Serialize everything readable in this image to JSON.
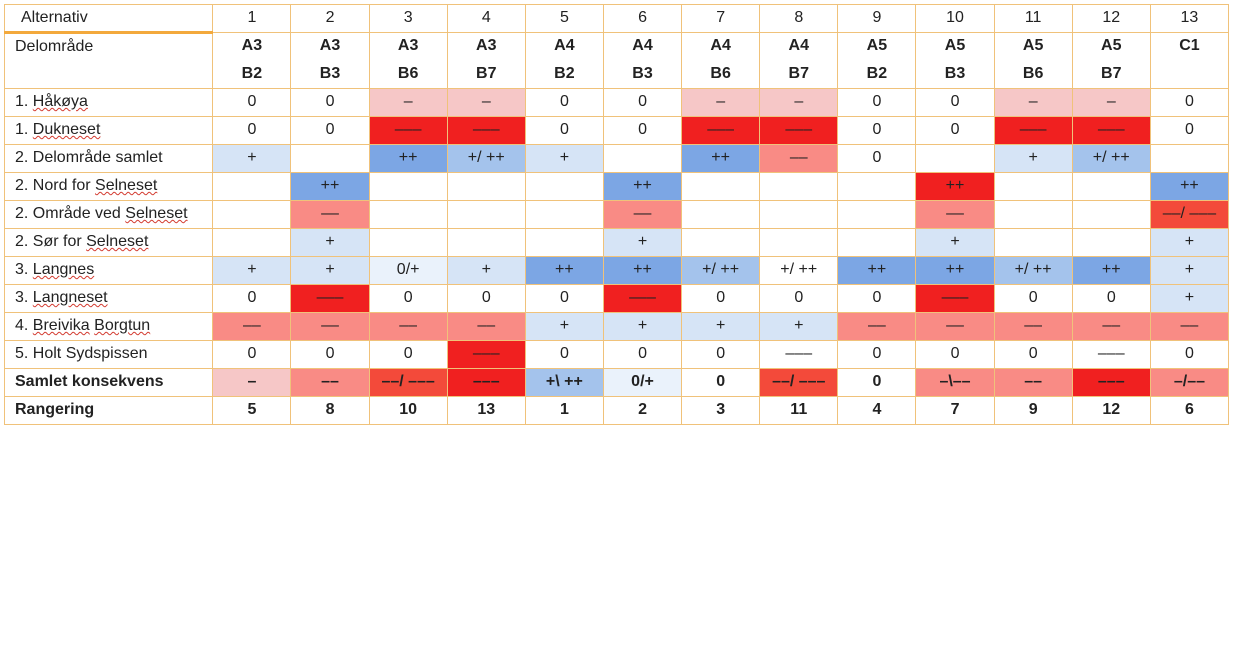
{
  "header": {
    "alt_label": "Alternativ",
    "del_label": "Delområde",
    "cols": [
      "1",
      "2",
      "3",
      "4",
      "5",
      "6",
      "7",
      "8",
      "9",
      "10",
      "11",
      "12",
      "13"
    ],
    "line1": [
      "A3",
      "A3",
      "A3",
      "A3",
      "A4",
      "A4",
      "A4",
      "A4",
      "A5",
      "A5",
      "A5",
      "A5",
      "C1"
    ],
    "line2": [
      "B2",
      "B3",
      "B6",
      "B7",
      "B2",
      "B3",
      "B6",
      "B7",
      "B2",
      "B3",
      "B6",
      "B7",
      ""
    ]
  },
  "rows": [
    {
      "label_pre": "1. ",
      "label_wavy": "Håkøya",
      "cells": [
        {
          "v": "0"
        },
        {
          "v": "0"
        },
        {
          "v": "–",
          "c": "c-pink"
        },
        {
          "v": "–",
          "c": "c-pink"
        },
        {
          "v": "0"
        },
        {
          "v": "0"
        },
        {
          "v": "–",
          "c": "c-pink"
        },
        {
          "v": "–",
          "c": "c-pink"
        },
        {
          "v": "0"
        },
        {
          "v": "0"
        },
        {
          "v": "–",
          "c": "c-pink"
        },
        {
          "v": "–",
          "c": "c-pink"
        },
        {
          "v": "0"
        }
      ]
    },
    {
      "label_pre": "1. ",
      "label_wavy": "Dukneset",
      "cells": [
        {
          "v": "0"
        },
        {
          "v": "0"
        },
        {
          "v": "–––",
          "c": "c-red"
        },
        {
          "v": "–––",
          "c": "c-red"
        },
        {
          "v": "0"
        },
        {
          "v": "0"
        },
        {
          "v": "–––",
          "c": "c-red"
        },
        {
          "v": "–––",
          "c": "c-red"
        },
        {
          "v": "0"
        },
        {
          "v": "0"
        },
        {
          "v": "–––",
          "c": "c-red"
        },
        {
          "v": "–––",
          "c": "c-red"
        },
        {
          "v": "0"
        }
      ]
    },
    {
      "label_pre": "2. Delområde samlet",
      "label_wavy": "",
      "cells": [
        {
          "v": "+",
          "c": "c-lblue"
        },
        {
          "v": ""
        },
        {
          "v": "++",
          "c": "c-blue"
        },
        {
          "v": "+/ ++",
          "c": "c-mblue"
        },
        {
          "v": "+",
          "c": "c-lblue"
        },
        {
          "v": ""
        },
        {
          "v": "++",
          "c": "c-blue"
        },
        {
          "v": "––",
          "c": "c-salmon"
        },
        {
          "v": "0"
        },
        {
          "v": ""
        },
        {
          "v": "+",
          "c": "c-lblue"
        },
        {
          "v": "+/ ++",
          "c": "c-mblue"
        },
        {
          "v": ""
        }
      ]
    },
    {
      "label_pre": "2. Nord for ",
      "label_wavy": "Selneset",
      "cells": [
        {
          "v": ""
        },
        {
          "v": "++",
          "c": "c-blue"
        },
        {
          "v": ""
        },
        {
          "v": ""
        },
        {
          "v": ""
        },
        {
          "v": "++",
          "c": "c-blue"
        },
        {
          "v": ""
        },
        {
          "v": ""
        },
        {
          "v": ""
        },
        {
          "v": "++",
          "c": "c-red"
        },
        {
          "v": ""
        },
        {
          "v": ""
        },
        {
          "v": "++",
          "c": "c-blue"
        }
      ]
    },
    {
      "label_pre": "2. Område ved ",
      "label_wavy": "Selneset",
      "cells": [
        {
          "v": ""
        },
        {
          "v": "––",
          "c": "c-salmon"
        },
        {
          "v": ""
        },
        {
          "v": ""
        },
        {
          "v": ""
        },
        {
          "v": "––",
          "c": "c-salmon"
        },
        {
          "v": ""
        },
        {
          "v": ""
        },
        {
          "v": ""
        },
        {
          "v": "––",
          "c": "c-salmon"
        },
        {
          "v": ""
        },
        {
          "v": ""
        },
        {
          "v": "––/ –––",
          "c": "c-redmed"
        }
      ]
    },
    {
      "label_pre": "2. Sør for ",
      "label_wavy": "Selneset",
      "cells": [
        {
          "v": ""
        },
        {
          "v": "+",
          "c": "c-lblue"
        },
        {
          "v": ""
        },
        {
          "v": ""
        },
        {
          "v": ""
        },
        {
          "v": "+",
          "c": "c-lblue"
        },
        {
          "v": ""
        },
        {
          "v": ""
        },
        {
          "v": ""
        },
        {
          "v": "+",
          "c": "c-lblue"
        },
        {
          "v": ""
        },
        {
          "v": ""
        },
        {
          "v": "+",
          "c": "c-lblue"
        }
      ]
    },
    {
      "label_pre": "3. ",
      "label_wavy": "Langnes",
      "cells": [
        {
          "v": "+",
          "c": "c-lblue"
        },
        {
          "v": "+",
          "c": "c-lblue"
        },
        {
          "v": "0/+",
          "c": "c-vlblue"
        },
        {
          "v": "+",
          "c": "c-lblue"
        },
        {
          "v": "++",
          "c": "c-blue"
        },
        {
          "v": "++",
          "c": "c-blue"
        },
        {
          "v": "+/ ++",
          "c": "c-mblue"
        },
        {
          "v": "+/ ++"
        },
        {
          "v": "++",
          "c": "c-blue"
        },
        {
          "v": "++",
          "c": "c-blue"
        },
        {
          "v": "+/ ++",
          "c": "c-mblue"
        },
        {
          "v": "++",
          "c": "c-blue"
        },
        {
          "v": "+",
          "c": "c-lblue"
        }
      ]
    },
    {
      "label_pre": "3. ",
      "label_wavy": "Langneset",
      "cells": [
        {
          "v": "0"
        },
        {
          "v": "–––",
          "c": "c-red"
        },
        {
          "v": "0"
        },
        {
          "v": "0"
        },
        {
          "v": "0"
        },
        {
          "v": "–––",
          "c": "c-red"
        },
        {
          "v": "0"
        },
        {
          "v": "0"
        },
        {
          "v": "0"
        },
        {
          "v": "–––",
          "c": "c-red"
        },
        {
          "v": "0"
        },
        {
          "v": "0"
        },
        {
          "v": "+",
          "c": "c-lblue"
        }
      ]
    },
    {
      "label_pre": "4. ",
      "label_wavy": "Breivika",
      "label_post": " ",
      "label_wavy2": "Borgtun",
      "cells": [
        {
          "v": "––",
          "c": "c-salmon"
        },
        {
          "v": "––",
          "c": "c-salmon"
        },
        {
          "v": "––",
          "c": "c-salmon"
        },
        {
          "v": "––",
          "c": "c-salmon"
        },
        {
          "v": "+",
          "c": "c-lblue"
        },
        {
          "v": "+",
          "c": "c-lblue"
        },
        {
          "v": "+",
          "c": "c-lblue"
        },
        {
          "v": "+",
          "c": "c-lblue"
        },
        {
          "v": "––",
          "c": "c-salmon"
        },
        {
          "v": "––",
          "c": "c-salmon"
        },
        {
          "v": "––",
          "c": "c-salmon"
        },
        {
          "v": "––",
          "c": "c-salmon"
        },
        {
          "v": "––",
          "c": "c-salmon"
        }
      ]
    },
    {
      "label_pre": "5. Holt Sydspissen",
      "label_wavy": "",
      "cells": [
        {
          "v": "0"
        },
        {
          "v": "0"
        },
        {
          "v": "0"
        },
        {
          "v": "–––",
          "c": "c-red"
        },
        {
          "v": "0"
        },
        {
          "v": "0"
        },
        {
          "v": "0"
        },
        {
          "v": "–––"
        },
        {
          "v": "0"
        },
        {
          "v": "0"
        },
        {
          "v": "0"
        },
        {
          "v": "–––"
        },
        {
          "v": "0"
        }
      ]
    },
    {
      "label_pre": "Samlet konsekvens",
      "label_wavy": "",
      "bold": true,
      "cells": [
        {
          "v": "–",
          "c": "c-pink"
        },
        {
          "v": "––",
          "c": "c-salmon"
        },
        {
          "v": "––/ –––",
          "c": "c-redmed"
        },
        {
          "v": "–––",
          "c": "c-red"
        },
        {
          "v": "+\\ ++",
          "c": "c-mblue"
        },
        {
          "v": "0/+",
          "c": "c-vlblue"
        },
        {
          "v": "0"
        },
        {
          "v": "––/ –––",
          "c": "c-redmed"
        },
        {
          "v": "0"
        },
        {
          "v": "–\\––",
          "c": "c-salmon"
        },
        {
          "v": "––",
          "c": "c-salmon"
        },
        {
          "v": "–––",
          "c": "c-red"
        },
        {
          "v": "–/––",
          "c": "c-salmon"
        }
      ]
    },
    {
      "label_pre": "Rangering",
      "label_wavy": "",
      "bold": true,
      "cells": [
        {
          "v": "5"
        },
        {
          "v": "8"
        },
        {
          "v": "10"
        },
        {
          "v": "13"
        },
        {
          "v": "1"
        },
        {
          "v": "2"
        },
        {
          "v": "3"
        },
        {
          "v": "11"
        },
        {
          "v": "4"
        },
        {
          "v": "7"
        },
        {
          "v": "9"
        },
        {
          "v": "12"
        },
        {
          "v": "6"
        }
      ]
    }
  ]
}
